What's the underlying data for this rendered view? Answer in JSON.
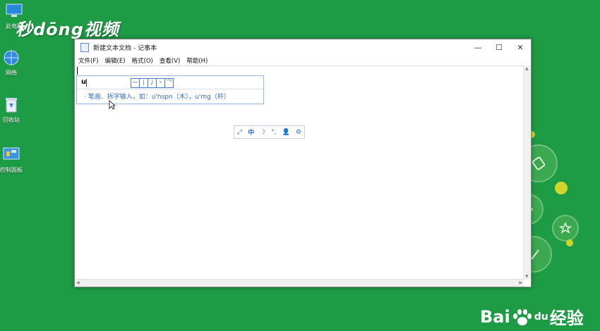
{
  "watermarks": {
    "top": "秒dōng视频",
    "baidu": "Baidu经验",
    "baidu_left": "Bai",
    "baidu_mid": "du",
    "baidu_right": "经验"
  },
  "desktop": {
    "icons": [
      {
        "label": "此电脑"
      },
      {
        "label": "网络"
      },
      {
        "label": "回收站"
      },
      {
        "label": "控制面板"
      }
    ]
  },
  "window": {
    "title": "新建文本文档 - 记事本",
    "controls": {
      "minimize": "—",
      "maximize": "☐",
      "close": "✕"
    },
    "menu": [
      "文件(F)",
      "编辑(E)",
      "格式(O)",
      "查看(V)",
      "帮助(H)"
    ]
  },
  "ime": {
    "input": "u",
    "strokes": [
      "一",
      "丨",
      "丿",
      "丶",
      "乛"
    ],
    "hint": "· 笔画、拆字输入，如：u'hspn（木），u'mg（杆）",
    "toolbar": [
      "⤢",
      "中",
      "☽",
      "°,",
      "👤",
      "⚙"
    ]
  },
  "colors": {
    "desktop_bg": "#1e9b45",
    "ime_accent": "#2f6cc9"
  }
}
